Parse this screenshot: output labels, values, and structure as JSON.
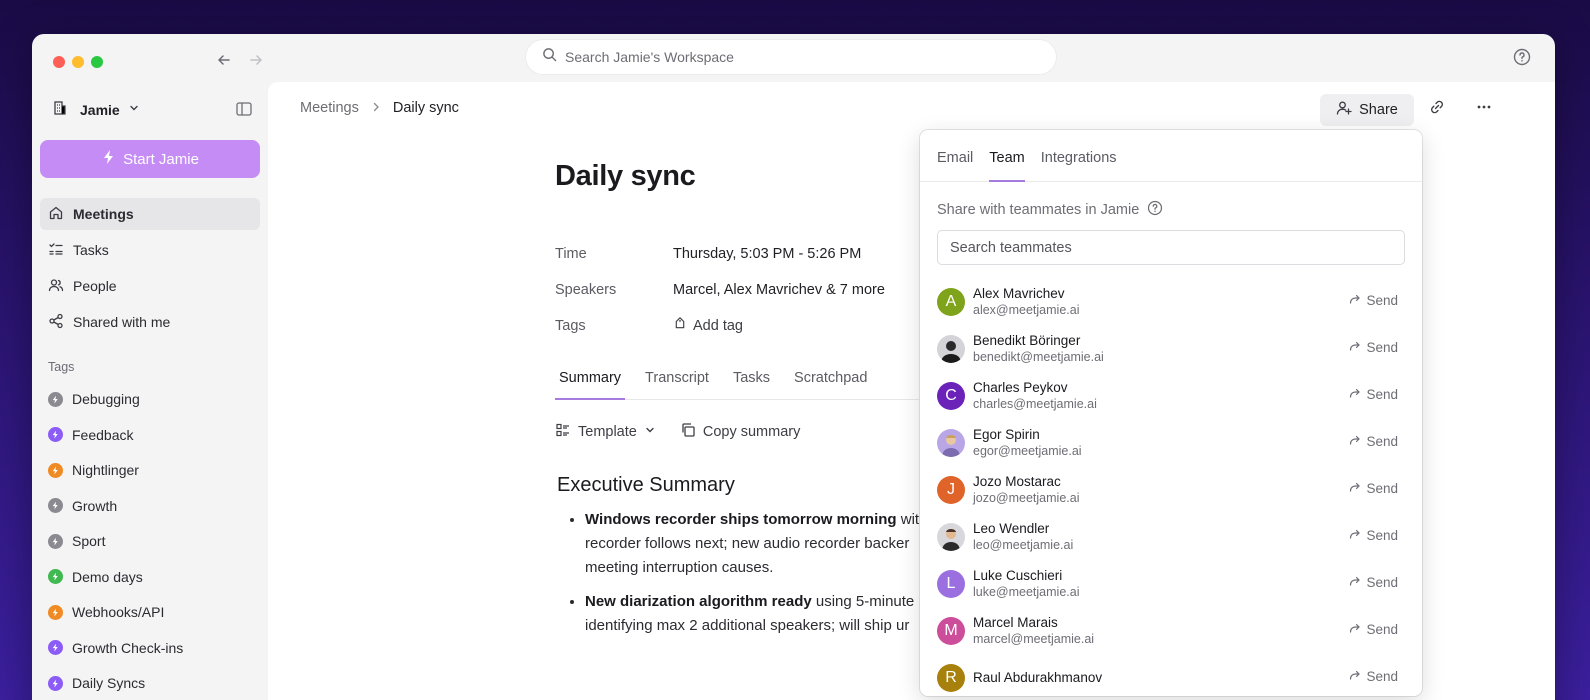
{
  "search": {
    "placeholder": "Search Jamie's Workspace"
  },
  "sidebar": {
    "workspace": "Jamie",
    "start_label": "Start Jamie",
    "nav": [
      {
        "label": "Meetings",
        "icon": "home-icon"
      },
      {
        "label": "Tasks",
        "icon": "tasks-icon"
      },
      {
        "label": "People",
        "icon": "people-icon"
      },
      {
        "label": "Shared with me",
        "icon": "share-icon"
      }
    ],
    "tags_label": "Tags",
    "tags": [
      {
        "label": "Debugging",
        "color": "#8a8a90"
      },
      {
        "label": "Feedback",
        "color": "#8b5cf6"
      },
      {
        "label": "Nightlinger",
        "color": "#f08a24"
      },
      {
        "label": "Growth",
        "color": "#8a8a90"
      },
      {
        "label": "Sport",
        "color": "#8a8a90"
      },
      {
        "label": "Demo days",
        "color": "#3fb950"
      },
      {
        "label": "Webhooks/API",
        "color": "#f08a24"
      },
      {
        "label": "Growth Check-ins",
        "color": "#8b5cf6"
      },
      {
        "label": "Daily Syncs",
        "color": "#8b5cf6"
      }
    ]
  },
  "breadcrumb": {
    "parent": "Meetings",
    "current": "Daily sync"
  },
  "header": {
    "share_label": "Share"
  },
  "doc": {
    "title": "Daily sync",
    "meta": {
      "time_key": "Time",
      "time_val": "Thursday, 5:03 PM - 5:26 PM",
      "speakers_key": "Speakers",
      "speakers_val": "Marcel, Alex Mavrichev & 7 more",
      "tags_key": "Tags",
      "tags_val": "Add tag"
    },
    "tabs": [
      "Summary",
      "Transcript",
      "Tasks",
      "Scratchpad"
    ],
    "template_label": "Template",
    "copy_label": "Copy summary",
    "exec_title": "Executive Summary",
    "bullets": [
      {
        "bold": "Windows recorder ships tomorrow morning",
        "rest": " with",
        "line2": "recorder follows next; new audio recorder backer",
        "line3": "meeting interruption causes."
      },
      {
        "bold": "New diarization algorithm ready",
        "rest": " using 5-minute",
        "line2": "identifying max 2 additional speakers; will ship ur",
        "line3": ""
      }
    ]
  },
  "share_panel": {
    "tabs": [
      "Email",
      "Team",
      "Integrations"
    ],
    "hint": "Share with teammates in Jamie",
    "search_placeholder": "Search teammates",
    "send_label": "Send",
    "members": [
      {
        "name": "Alex Mavrichev",
        "email": "alex@meetjamie.ai",
        "initial": "A",
        "color": "#7fa31a"
      },
      {
        "name": "Benedikt Böringer",
        "email": "benedikt@meetjamie.ai",
        "initial": "",
        "color": "#5c5c5c"
      },
      {
        "name": "Charles Peykov",
        "email": "charles@meetjamie.ai",
        "initial": "C",
        "color": "#6a22b8"
      },
      {
        "name": "Egor Spirin",
        "email": "egor@meetjamie.ai",
        "initial": "",
        "color": "#b9a6e6"
      },
      {
        "name": "Jozo Mostarac",
        "email": "jozo@meetjamie.ai",
        "initial": "J",
        "color": "#e0642a"
      },
      {
        "name": "Leo Wendler",
        "email": "leo@meetjamie.ai",
        "initial": "",
        "color": "#d8d8dc"
      },
      {
        "name": "Luke Cuschieri",
        "email": "luke@meetjamie.ai",
        "initial": "L",
        "color": "#9b6fe0"
      },
      {
        "name": "Marcel Marais",
        "email": "marcel@meetjamie.ai",
        "initial": "M",
        "color": "#cc4e9a"
      },
      {
        "name": "Raul Abdurakhmanov",
        "email": "",
        "initial": "R",
        "color": "#a8800c"
      }
    ]
  }
}
